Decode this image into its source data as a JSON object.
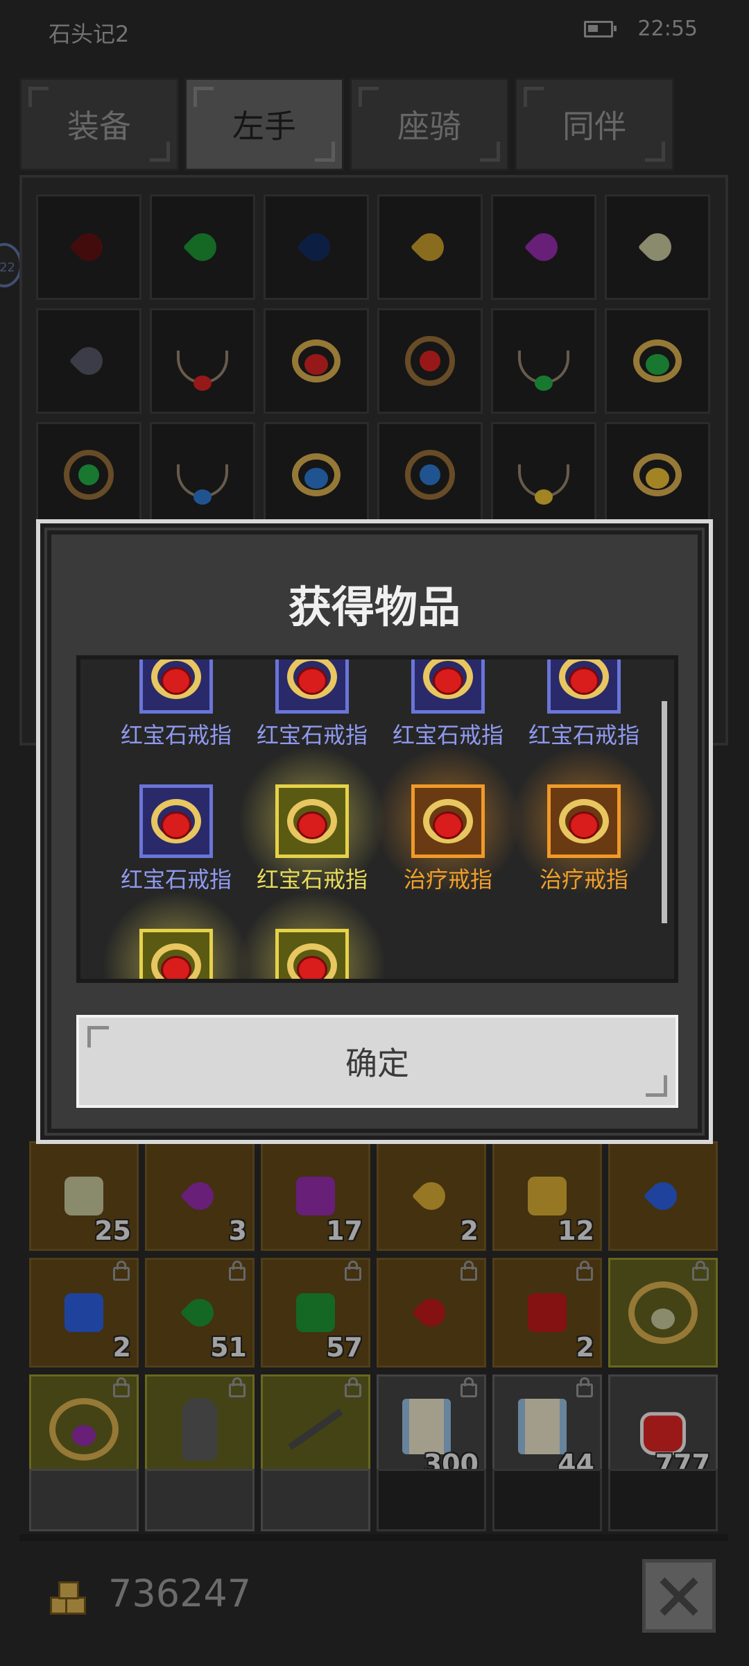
{
  "status": {
    "app_title": "石头记2",
    "time": "22:55"
  },
  "tabs": [
    {
      "label": "装备"
    },
    {
      "label": "左手"
    },
    {
      "label": "座骑"
    },
    {
      "label": "同伴"
    }
  ],
  "side_badge": "22",
  "dialog": {
    "title": "获得物品",
    "items": [
      {
        "label": "红宝石戒指",
        "rarity": "blue"
      },
      {
        "label": "红宝石戒指",
        "rarity": "blue"
      },
      {
        "label": "红宝石戒指",
        "rarity": "blue"
      },
      {
        "label": "红宝石戒指",
        "rarity": "blue"
      },
      {
        "label": "红宝石戒指",
        "rarity": "blue"
      },
      {
        "label": "红宝石戒指",
        "rarity": "yellow"
      },
      {
        "label": "治疗戒指",
        "rarity": "orange"
      },
      {
        "label": "治疗戒指",
        "rarity": "orange"
      }
    ],
    "confirm_label": "确定"
  },
  "bag": {
    "counts": [
      "25",
      "3",
      "17",
      "2",
      "12",
      "2",
      "51",
      "57",
      "2",
      "300",
      "44",
      "777"
    ]
  },
  "currency": {
    "amount": "736247"
  }
}
